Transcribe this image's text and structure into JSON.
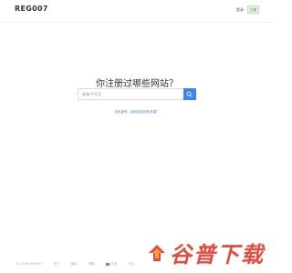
{
  "header": {
    "logo": "REG007",
    "login_label": "登录",
    "register_label": "注册"
  },
  "main": {
    "headline": "你注册过哪些网站？",
    "search_placeholder": "邮箱/手机号",
    "hint_link": "手机被停，如何找回你的资源？"
  },
  "footer": {
    "copyright": "© 2018 REG007",
    "links": [
      "关于",
      "隐私",
      "帮助",
      "反馈",
      "中文"
    ]
  },
  "watermark": {
    "text": "谷普下载"
  },
  "colors": {
    "accent": "#3d84f0",
    "link": "#4a84d8",
    "register": "#4a9c4a",
    "watermark": "#e84b3c"
  },
  "icons": {
    "search": "search-icon",
    "flag": "flag-icon",
    "watermark_logo": "download-logo-icon"
  }
}
